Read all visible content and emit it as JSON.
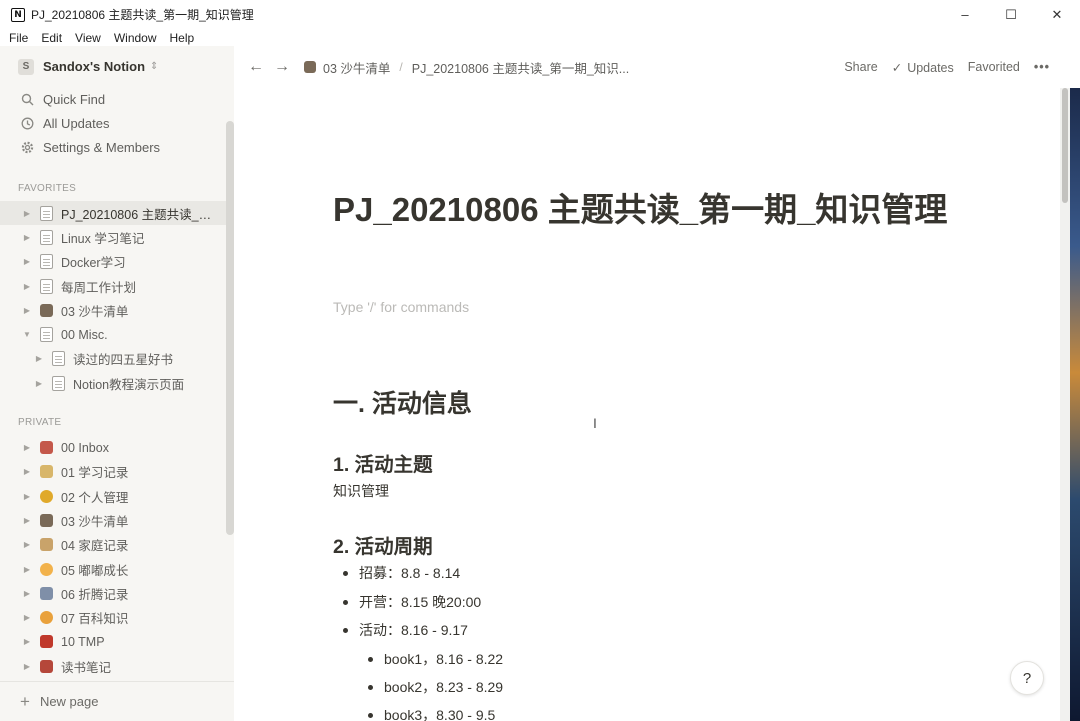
{
  "window": {
    "title": "PJ_20210806 主题共读_第一期_知识管理",
    "app_icon": "N",
    "controls": [
      "–",
      "☐",
      "✕"
    ]
  },
  "menubar": [
    "File",
    "Edit",
    "View",
    "Window",
    "Help"
  ],
  "sidebar": {
    "workspace_badge": "S",
    "workspace_name": "Sandox's Notion",
    "links": [
      {
        "label": "Quick Find",
        "icon": "search-icon"
      },
      {
        "label": "All Updates",
        "icon": "clock-icon"
      },
      {
        "label": "Settings & Members",
        "icon": "gear-icon"
      }
    ],
    "favorites_title": "FAVORITES",
    "favorites": [
      {
        "label": "PJ_20210806 主题共读_第...",
        "icon": "page-icon",
        "expanded": false,
        "active": true,
        "indent": 0
      },
      {
        "label": "Linux 学习笔记",
        "icon": "page-icon",
        "expanded": false,
        "indent": 0
      },
      {
        "label": "Docker学习",
        "icon": "page-icon",
        "expanded": false,
        "indent": 0
      },
      {
        "label": "每周工作计划",
        "icon": "page-icon",
        "expanded": false,
        "indent": 0
      },
      {
        "label": "03 沙牛清单",
        "icon": "person-emoji-icon",
        "expanded": false,
        "indent": 0
      },
      {
        "label": "00 Misc.",
        "icon": "page-icon",
        "expanded": true,
        "indent": 0
      },
      {
        "label": "读过的四五星好书",
        "icon": "page-icon",
        "expanded": false,
        "indent": 1
      },
      {
        "label": "Notion教程演示页面",
        "icon": "page-icon",
        "expanded": false,
        "indent": 1
      }
    ],
    "private_title": "PRIVATE",
    "private": [
      {
        "label": "00 Inbox",
        "icon": "inbox-emoji-icon",
        "color": "#c4584a"
      },
      {
        "label": "01 学习记录",
        "icon": "pencil-emoji-icon",
        "color": "#d8b66a"
      },
      {
        "label": "02 个人管理",
        "icon": "medal-emoji-icon",
        "color": "#e0a92a"
      },
      {
        "label": "03 沙牛清单",
        "icon": "person-emoji-icon",
        "color": "#7a6a58"
      },
      {
        "label": "04 家庭记录",
        "icon": "house-emoji-icon",
        "color": "#c9a36a"
      },
      {
        "label": "05 嘟嘟成长",
        "icon": "baby-emoji-icon",
        "color": "#f2b24b"
      },
      {
        "label": "06 折腾记录",
        "icon": "tool-emoji-icon",
        "color": "#7f8fa8"
      },
      {
        "label": "07 百科知识",
        "icon": "star-emoji-icon",
        "color": "#e9a13b"
      },
      {
        "label": "10 TMP",
        "icon": "toolbox-emoji-icon",
        "color": "#c0392b"
      },
      {
        "label": "读书笔记",
        "icon": "book-emoji-icon",
        "color": "#b5473a"
      }
    ],
    "new_page": "New page"
  },
  "topbar": {
    "breadcrumb_parent": "03 沙牛清单",
    "breadcrumb_current": "PJ_20210806 主题共读_第一期_知识...",
    "share": "Share",
    "updates": "Updates",
    "favorited": "Favorited",
    "more": "•••"
  },
  "doc": {
    "title": "PJ_20210806 主题共读_第一期_知识管理",
    "placeholder": "Type '/' for commands",
    "heading1": "一. 活动信息",
    "section1_title": "1. 活动主题",
    "section1_text": "知识管理",
    "section2_title": "2. 活动周期",
    "bullets": [
      "招募：8.8 - 8.14",
      "开营：8.15 晚20:00",
      "活动：8.16 - 9.17"
    ],
    "sub_bullets": [
      "book1，8.16 - 8.22",
      "book2，8.23 - 8.29",
      "book3，8.30 - 9.5"
    ]
  },
  "help": "?"
}
